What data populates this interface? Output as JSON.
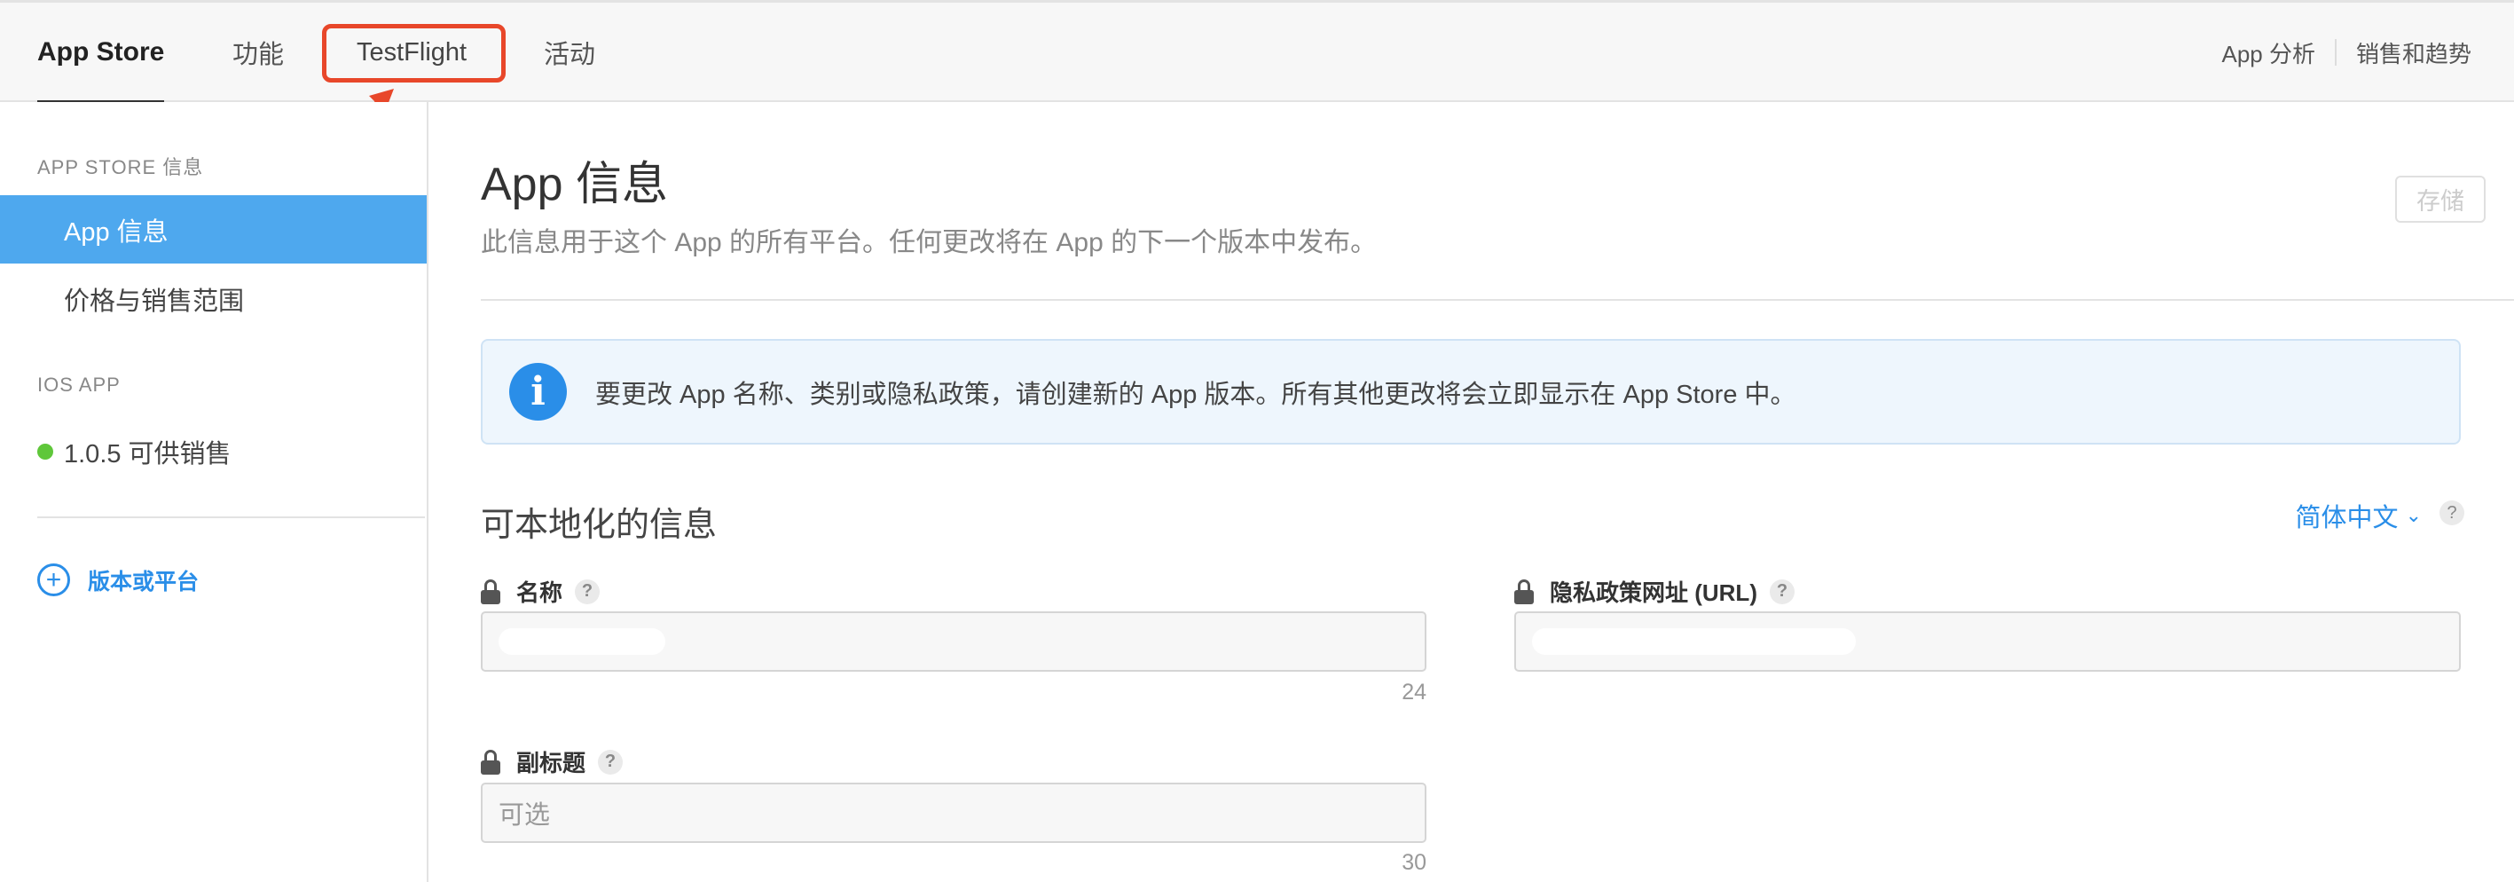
{
  "topnav": {
    "tabs": [
      {
        "label": "App Store"
      },
      {
        "label": "功能"
      },
      {
        "label": "TestFlight"
      },
      {
        "label": "活动"
      }
    ],
    "right_links": [
      "App 分析",
      "销售和趋势"
    ],
    "highlight_color": "#e8472a"
  },
  "sidebar": {
    "section_appstore": "APP STORE 信息",
    "items": [
      {
        "label": "App 信息"
      },
      {
        "label": "价格与销售范围"
      }
    ],
    "section_ios": "IOS APP",
    "version_status": "1.0.5 可供销售",
    "status_color": "#5fc73a",
    "add_label": "版本或平台"
  },
  "main": {
    "title": "App 信息",
    "subtitle": "此信息用于这个 App 的所有平台。任何更改将在 App 的下一个版本中发布。",
    "save_label": "存储",
    "banner": {
      "icon": "i",
      "text": "要更改 App 名称、类别或隐私政策，请创建新的 App 版本。所有其他更改将会立即显示在 App Store 中。"
    },
    "localizable": {
      "title": "可本地化的信息",
      "language": "简体中文",
      "help": "?"
    },
    "fields": {
      "name": {
        "label": "名称",
        "help": "?",
        "counter": "24"
      },
      "privacy": {
        "label": "隐私政策网址 (URL)",
        "help": "?"
      },
      "subtitle": {
        "label": "副标题",
        "help": "?",
        "placeholder": "可选",
        "counter": "30"
      }
    }
  }
}
